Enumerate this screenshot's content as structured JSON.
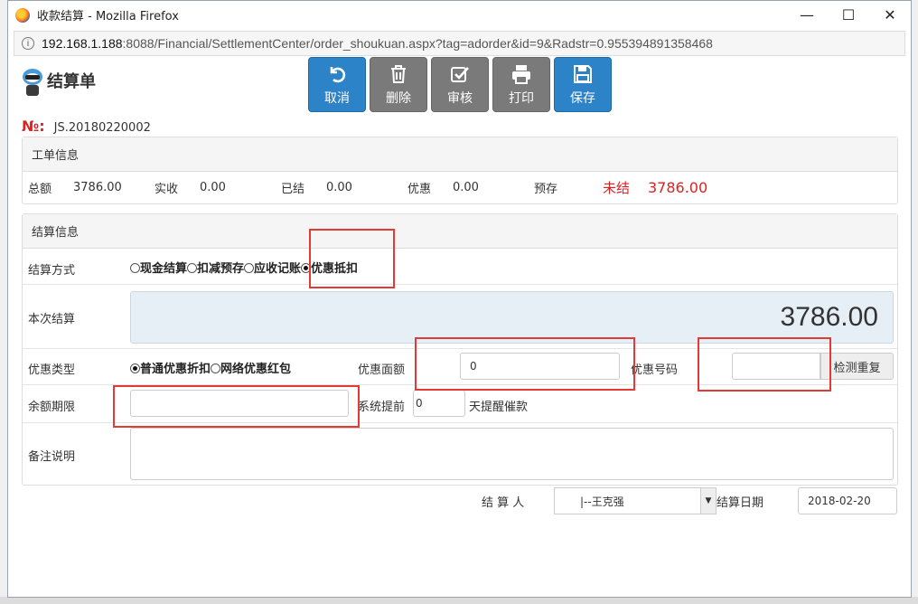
{
  "window": {
    "title": "收款结算 - Mozilla Firefox",
    "minimize": "—",
    "maximize": "☐",
    "close": "✕"
  },
  "address": {
    "host": "192.168.1.188",
    "rest": ":8088/Financial/SettlementCenter/order_shoukuan.aspx?tag=adorder&id=9&Radstr=0.955394891358468"
  },
  "header": {
    "title": "结算单"
  },
  "toolbar": [
    {
      "label": "取消",
      "icon": "undo-icon"
    },
    {
      "label": "删除",
      "icon": "trash-icon"
    },
    {
      "label": "审核",
      "icon": "check-square-icon"
    },
    {
      "label": "打印",
      "icon": "printer-icon"
    },
    {
      "label": "保存",
      "icon": "floppy-icon"
    }
  ],
  "doc": {
    "no_label": "№:",
    "no_value": "JS.20180220002"
  },
  "work_info": {
    "title": "工单信息",
    "total_label": "总额",
    "total_value": "3786.00",
    "received_label": "实收",
    "received_value": "0.00",
    "settled_label": "已结",
    "settled_value": "0.00",
    "discount_label": "优惠",
    "discount_value": "0.00",
    "deposit_label": "预存",
    "unsettled_label": "未结",
    "unsettled_value": "3786.00"
  },
  "settle_info": {
    "title": "结算信息",
    "method_label": "结算方式",
    "methods": [
      "现金结算",
      "扣减预存",
      "应收记账",
      "优惠抵扣"
    ],
    "selected_method": "优惠抵扣",
    "amount_label": "本次结算",
    "amount_value": "3786.00",
    "discount_type_label": "优惠类型",
    "discount_types": [
      "普通优惠折扣",
      "网络优惠红包"
    ],
    "selected_discount_type": "普通优惠折扣",
    "discount_amount_label": "优惠面额",
    "discount_amount_value": "0",
    "discount_code_label": "优惠号码",
    "discount_code_value": "",
    "check_dup_label": "检测重复",
    "balance_term_label": "余额期限",
    "balance_term_value": "",
    "remind_prefix": "系统提前",
    "remind_days": "0",
    "remind_suffix": "天提醒催款",
    "remark_label": "备注说明"
  },
  "footer": {
    "settler_label": "结 算 人",
    "settler_value": "|--王克强",
    "date_label": "结算日期",
    "date_value": "2018-02-20"
  },
  "colors": {
    "primary_button": "#2c83c8",
    "gray_button": "#7a7a7a",
    "alert_red": "#e53935"
  }
}
